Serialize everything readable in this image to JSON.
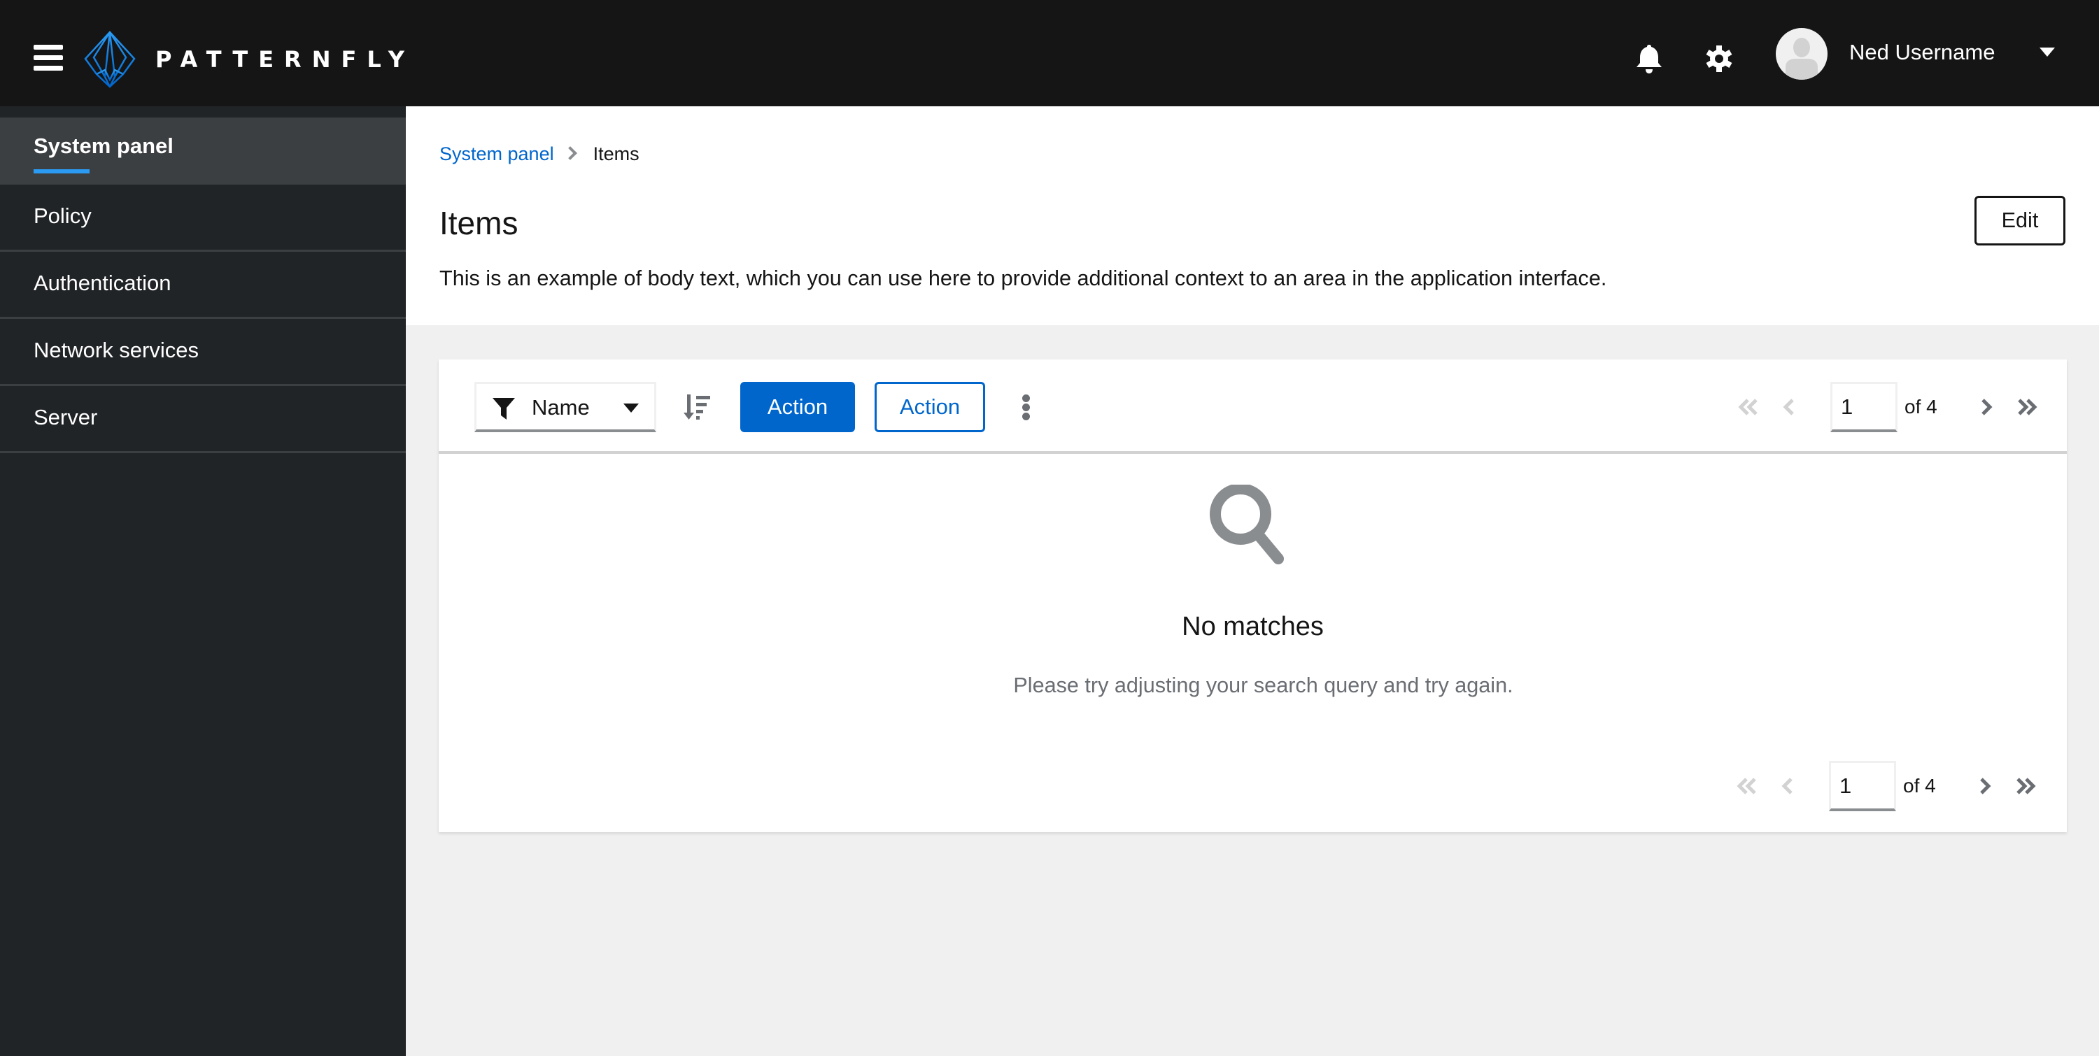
{
  "masthead": {
    "brand": "PATTERNFLY",
    "icons": [
      "hamburger-menu-icon",
      "patternfly-logo",
      "bell-icon",
      "gear-icon",
      "avatar",
      "caret-down-icon"
    ],
    "user_name": "Ned Username"
  },
  "sidebar": {
    "items": [
      {
        "label": "System panel",
        "active": true
      },
      {
        "label": "Policy",
        "active": false
      },
      {
        "label": "Authentication",
        "active": false
      },
      {
        "label": "Network services",
        "active": false
      },
      {
        "label": "Server",
        "active": false
      }
    ]
  },
  "page": {
    "breadcrumb": [
      {
        "label": "System panel",
        "link": true
      },
      {
        "label": "Items",
        "link": false
      }
    ],
    "title": "Items",
    "description": "This is an example of body text, which you can use here to provide additional context to an area in the application interface.",
    "edit_label": "Edit"
  },
  "toolbar": {
    "filter_select": "Name",
    "primary_action": "Action",
    "secondary_action": "Action",
    "icons": [
      "filter-icon",
      "sort-icon",
      "kebab-icon"
    ]
  },
  "pagination": {
    "current_page": "1",
    "of_label": "of 4",
    "total_pages": 4
  },
  "empty_state": {
    "icon": "search-icon",
    "title": "No matches",
    "body": "Please try adjusting your search query and try again."
  },
  "colors": {
    "masthead_bg": "#151515",
    "sidebar_bg": "#212427",
    "sidebar_active_bg": "#3c3f42",
    "active_indicator": "#2b9af3",
    "primary": "#0066cc",
    "page_bg": "#f0f0f0"
  }
}
